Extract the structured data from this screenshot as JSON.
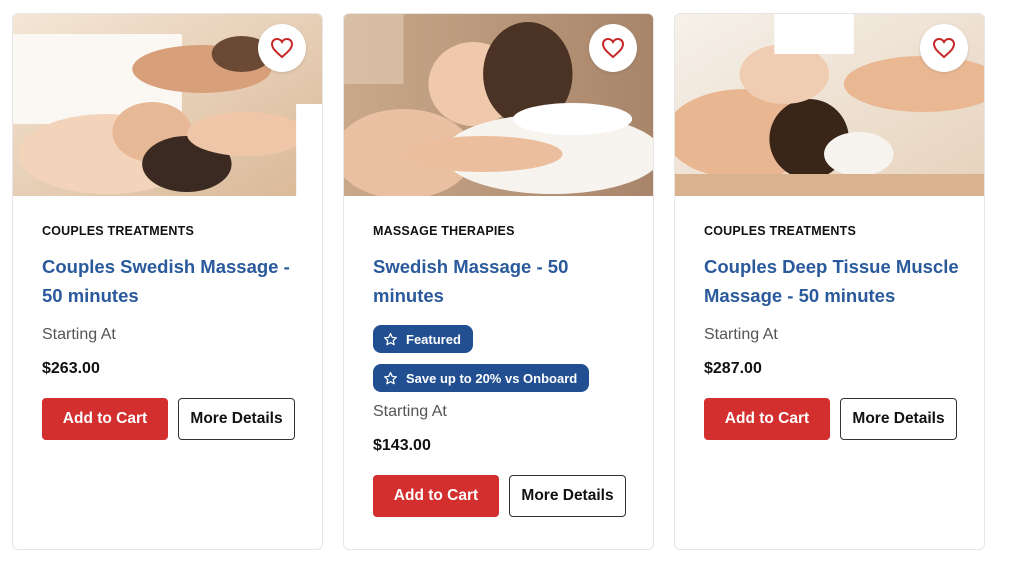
{
  "colors": {
    "accent_blue": "#2a5a9b",
    "badge_blue": "#214f92",
    "cart_red": "#d32f2f",
    "heart_red": "#c62828"
  },
  "cards": [
    {
      "category": "COUPLES TREATMENTS",
      "title": "Couples Swedish Massage - 50 minutes",
      "starting_label": "Starting At",
      "price": "$263.00",
      "add_to_cart": "Add to Cart",
      "more_details": "More Details",
      "favorite_icon": "heart-outline-icon"
    },
    {
      "category": "MASSAGE THERAPIES",
      "title": "Swedish Massage - 50 minutes",
      "badges": [
        {
          "icon": "star-outline-icon",
          "label": "Featured"
        },
        {
          "icon": "star-outline-icon",
          "label": "Save up to 20% vs Onboard"
        }
      ],
      "starting_label": "Starting At",
      "price": "$143.00",
      "add_to_cart": "Add to Cart",
      "more_details": "More Details",
      "favorite_icon": "heart-outline-icon"
    },
    {
      "category": "COUPLES TREATMENTS",
      "title": "Couples Deep Tissue Muscle Massage - 50 minutes",
      "starting_label": "Starting At",
      "price": "$287.00",
      "add_to_cart": "Add to Cart",
      "more_details": "More Details",
      "favorite_icon": "heart-outline-icon"
    }
  ]
}
